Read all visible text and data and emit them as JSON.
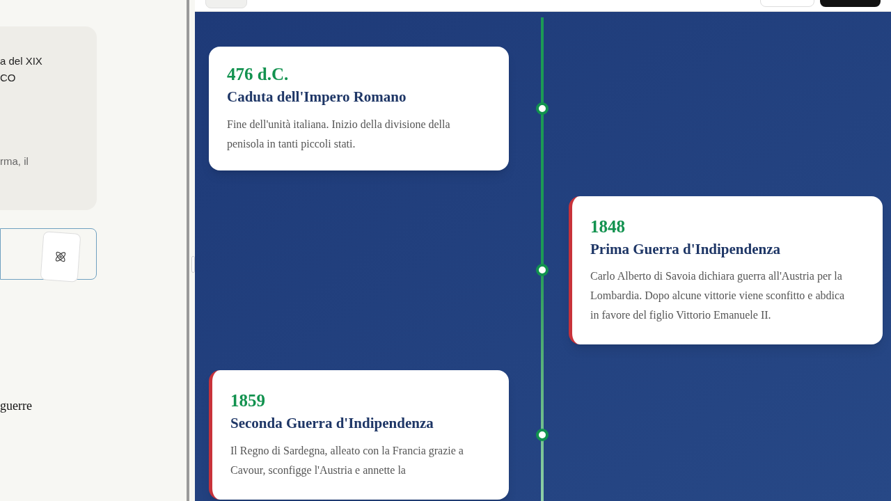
{
  "sidebar": {
    "card_lines": [
      "a del XIX",
      "CO",
      "rma, il"
    ],
    "text_fragment": "guerre"
  },
  "timeline": {
    "events": [
      {
        "kind": "left",
        "accent": false,
        "year": "476 d.C.",
        "title": "Caduta dell'Impero Romano",
        "text": "Fine dell'unità italiana. Inizio della divisione della penisola in tanti piccoli stati."
      },
      {
        "kind": "right",
        "accent": true,
        "year": "1848",
        "title": "Prima Guerra d'Indipendenza",
        "text": "Carlo Alberto di Savoia dichiara guerra all'Austria per la Lombardia. Dopo alcune vittorie viene sconfitto e abdica in favore del figlio Vittorio Emanuele II."
      },
      {
        "kind": "left",
        "accent": true,
        "year": "1859",
        "title": "Seconda Guerra d'Indipendenza",
        "text": "Il Regno di Sardegna, alleato con la Francia grazie a Cavour, sconfigge l'Austria e annette la"
      }
    ]
  }
}
